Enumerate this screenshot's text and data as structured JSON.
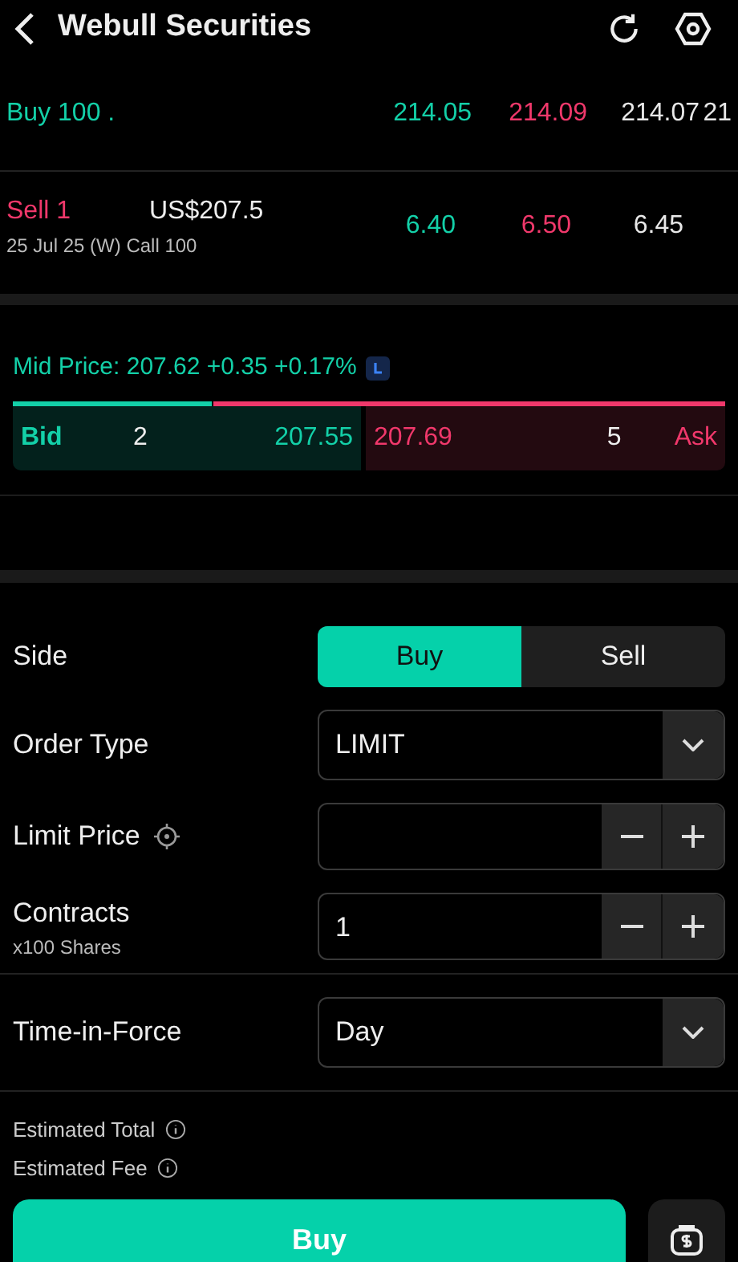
{
  "header": {
    "title": "Webull Securities"
  },
  "legs": [
    {
      "kind": "stock",
      "action": "Buy 100 .",
      "prices": [
        "214.05",
        "214.09",
        "214.07",
        "21"
      ]
    },
    {
      "kind": "option",
      "action": "Sell 1",
      "strike": "US$207.5",
      "detail": "25 Jul 25 (W) Call 100",
      "prices": [
        "6.40",
        "6.50",
        "6.45"
      ]
    }
  ],
  "mid_price": "Mid Price: 207.62 +0.35 +0.17%",
  "quote": {
    "bid_label": "Bid",
    "bid_size": "2",
    "bid_price": "207.55",
    "ask_price": "207.69",
    "ask_size": "5",
    "ask_label": "Ask"
  },
  "form": [
    {
      "kind": "segment",
      "label": "Side",
      "options": [
        {
          "label": "Buy",
          "selected": true
        },
        {
          "label": "Sell",
          "selected": false
        }
      ]
    },
    {
      "kind": "select",
      "label": "Order Type",
      "value": "LIMIT"
    },
    {
      "kind": "stepper",
      "label": "Limit Price",
      "target": true
    },
    {
      "kind": "stepper",
      "label": "Contracts",
      "sublabel": "x100 Shares",
      "value": "1"
    },
    {
      "kind": "select",
      "label": "Time-in-Force",
      "value": "Day",
      "divider": true
    }
  ],
  "estimates": [
    "Estimated Total",
    "Estimated Fee"
  ],
  "submit": "Buy"
}
